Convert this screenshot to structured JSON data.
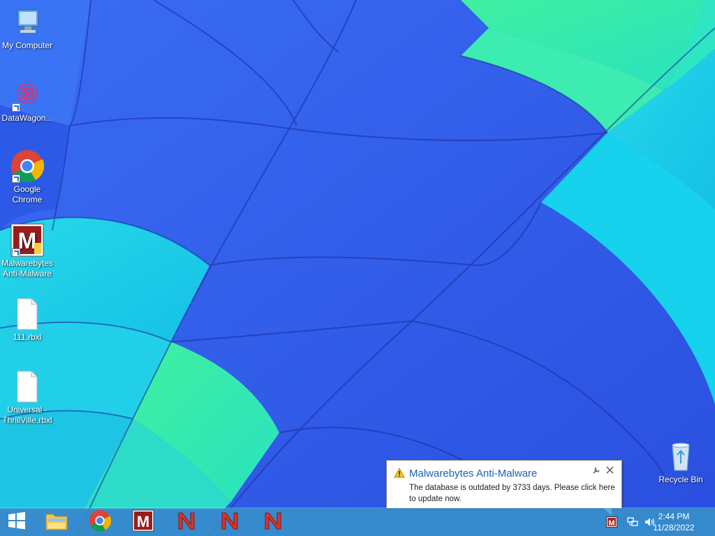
{
  "desktop": {
    "icons": [
      {
        "label": "My Computer"
      },
      {
        "label": "DataWagon..."
      },
      {
        "label": "Google\nChrome"
      },
      {
        "label": "Malwarebytes\nAnti-Malware"
      },
      {
        "label": "111.rbxl"
      },
      {
        "label": "Universal -\nThrillVille.rbxl"
      },
      {
        "label": "Recycle Bin"
      }
    ]
  },
  "notification": {
    "title": "Malwarebytes Anti-Malware",
    "message": "The database is outdated by 3733 days. Please click here to update now."
  },
  "tray": {
    "time": "2:44 PM",
    "date": "11/28/2022"
  },
  "colors": {
    "taskbar": "#3896c8",
    "accent": "#1c5fb6"
  }
}
